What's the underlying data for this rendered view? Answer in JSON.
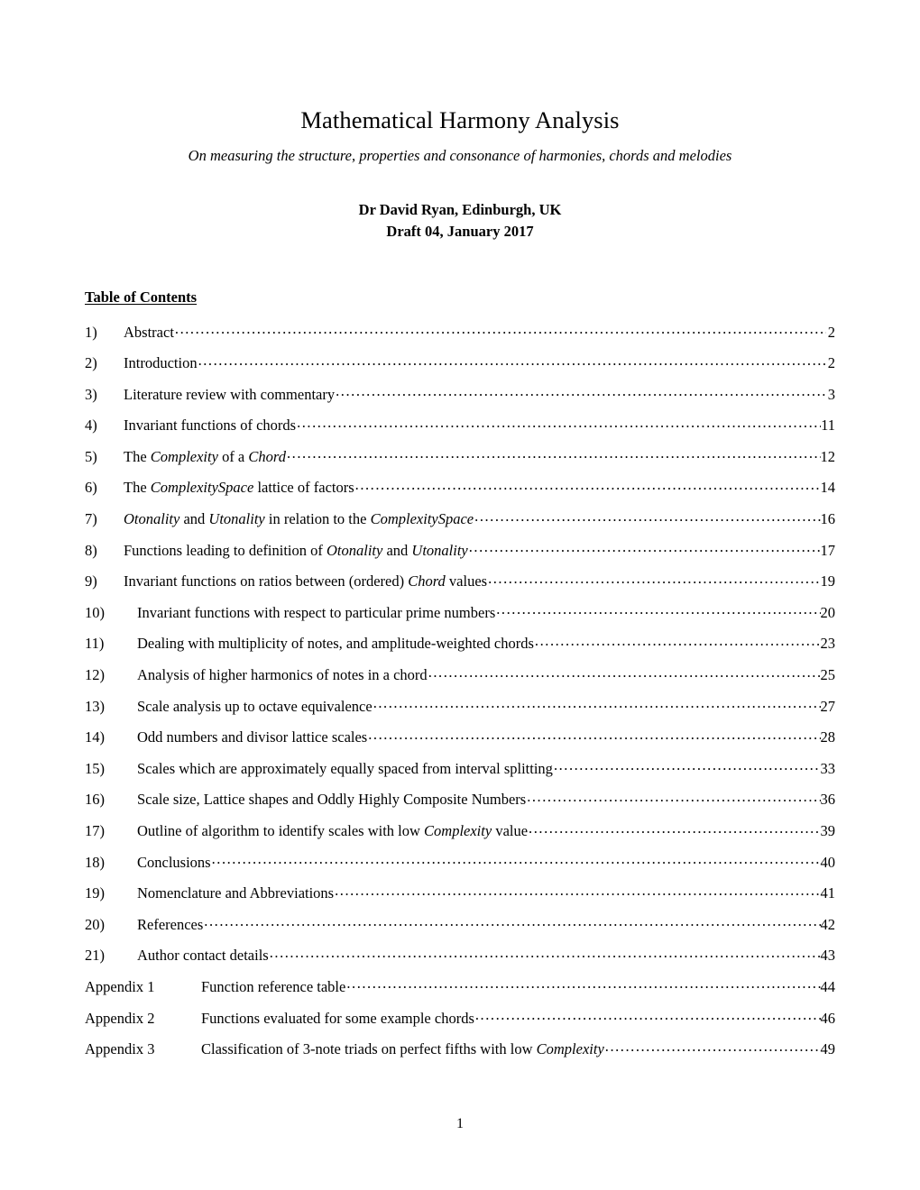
{
  "document": {
    "title": "Mathematical Harmony Analysis",
    "subtitle": "On measuring the structure, properties and consonance of harmonies, chords and melodies",
    "author": "Dr David Ryan, Edinburgh, UK",
    "draft": "Draft 04, January 2017",
    "footer_page_number": "1"
  },
  "toc": {
    "heading": "Table of Contents",
    "entries": [
      {
        "number": "1)",
        "text": "Abstract",
        "page": "2"
      },
      {
        "number": "2)",
        "text": "Introduction",
        "page": "2"
      },
      {
        "number": "3)",
        "text": "Literature review with commentary",
        "page": "3"
      },
      {
        "number": "4)",
        "text": "Invariant functions of chords",
        "page": "11"
      },
      {
        "number": "5)",
        "text": "The Complexity of a Chord",
        "page": "12"
      },
      {
        "number": "6)",
        "text": "The ComplexitySpace lattice of factors",
        "page": "14"
      },
      {
        "number": "7)",
        "text": "Otonality and Utonality in relation to the ComplexitySpace",
        "page": "16"
      },
      {
        "number": "8)",
        "text": "Functions leading to definition of Otonality and Utonality",
        "page": "17"
      },
      {
        "number": "9)",
        "text": "Invariant functions on ratios between (ordered) Chord values",
        "page": "19"
      },
      {
        "number": "10)",
        "text": "Invariant functions with respect to particular prime numbers",
        "page": "20"
      },
      {
        "number": "11)",
        "text": "Dealing with multiplicity of notes, and amplitude-weighted chords",
        "page": "23"
      },
      {
        "number": "12)",
        "text": "Analysis of higher harmonics of notes in a chord",
        "page": "25"
      },
      {
        "number": "13)",
        "text": "Scale analysis up to octave equivalence",
        "page": "27"
      },
      {
        "number": "14)",
        "text": "Odd numbers and divisor lattice scales",
        "page": "28"
      },
      {
        "number": "15)",
        "text": "Scales which are approximately equally spaced from interval splitting",
        "page": "33"
      },
      {
        "number": "16)",
        "text": "Scale size, Lattice shapes and Oddly Highly Composite Numbers",
        "page": "36"
      },
      {
        "number": "17)",
        "text": "Outline of algorithm to identify scales with low Complexity value",
        "page": "39"
      },
      {
        "number": "18)",
        "text": "Conclusions",
        "page": "40"
      },
      {
        "number": "19)",
        "text": "Nomenclature and Abbreviations",
        "page": "41"
      },
      {
        "number": "20)",
        "text": "References",
        "page": "42"
      },
      {
        "number": "21)",
        "text": "Author contact details",
        "page": "43"
      },
      {
        "number": "Appendix 1",
        "text": "Function reference table",
        "page": "44"
      },
      {
        "number": "Appendix 2",
        "text": "Functions evaluated for some example chords",
        "page": "46"
      },
      {
        "number": "Appendix 3",
        "text": "Classification of 3-note triads on perfect fifths with low Complexity",
        "page": "49"
      }
    ],
    "italic_terms": [
      "Complexity",
      "Chord",
      "ComplexitySpace",
      "Otonality",
      "Utonality"
    ]
  }
}
